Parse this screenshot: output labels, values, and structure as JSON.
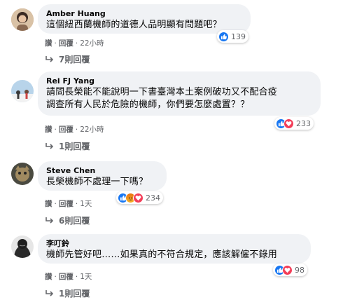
{
  "comments": [
    {
      "author": "Amber Huang",
      "lines": [
        "這個紐西蘭機師的道德人品明顯有問題吧？"
      ],
      "reactions": [
        "like-icon"
      ],
      "reaction_count": "139",
      "like_label": "讚",
      "reply_label": "回覆",
      "time": "22小時",
      "replies_label": "7則回覆"
    },
    {
      "author": "Rei FJ Yang",
      "lines": [
        "請問長榮能不能說明一下書臺灣本土案例破功又不配合疫",
        "調查所有人民於危險的機師，你們要怎麼處置？？"
      ],
      "reactions": [
        "like-icon",
        "love-icon"
      ],
      "reaction_count": "233",
      "like_label": "讚",
      "reply_label": "回覆",
      "time": "22小時",
      "replies_label": "1則回覆"
    },
    {
      "author": "Steve Chen",
      "lines": [
        "長榮機師不處理一下嗎？"
      ],
      "reactions": [
        "like-icon",
        "angry-icon",
        "love-icon"
      ],
      "reaction_count": "234",
      "like_label": "讚",
      "reply_label": "回覆",
      "time": "1天",
      "replies_label": "6則回覆"
    },
    {
      "author": "李叮鈴",
      "lines": [
        "機師先管好吧……如果真的不符合規定，應該解僱不錄用"
      ],
      "reactions": [
        "like-icon",
        "love-icon"
      ],
      "reaction_count": "98",
      "like_label": "讚",
      "reply_label": "回覆",
      "time": "1天",
      "replies_label": "1則回覆"
    }
  ],
  "colors": {
    "bubble": "#f0f2f5",
    "secondary_text": "#65676b",
    "like": "#1877f2",
    "love": "#f33e58",
    "angry": "#f7b125"
  }
}
